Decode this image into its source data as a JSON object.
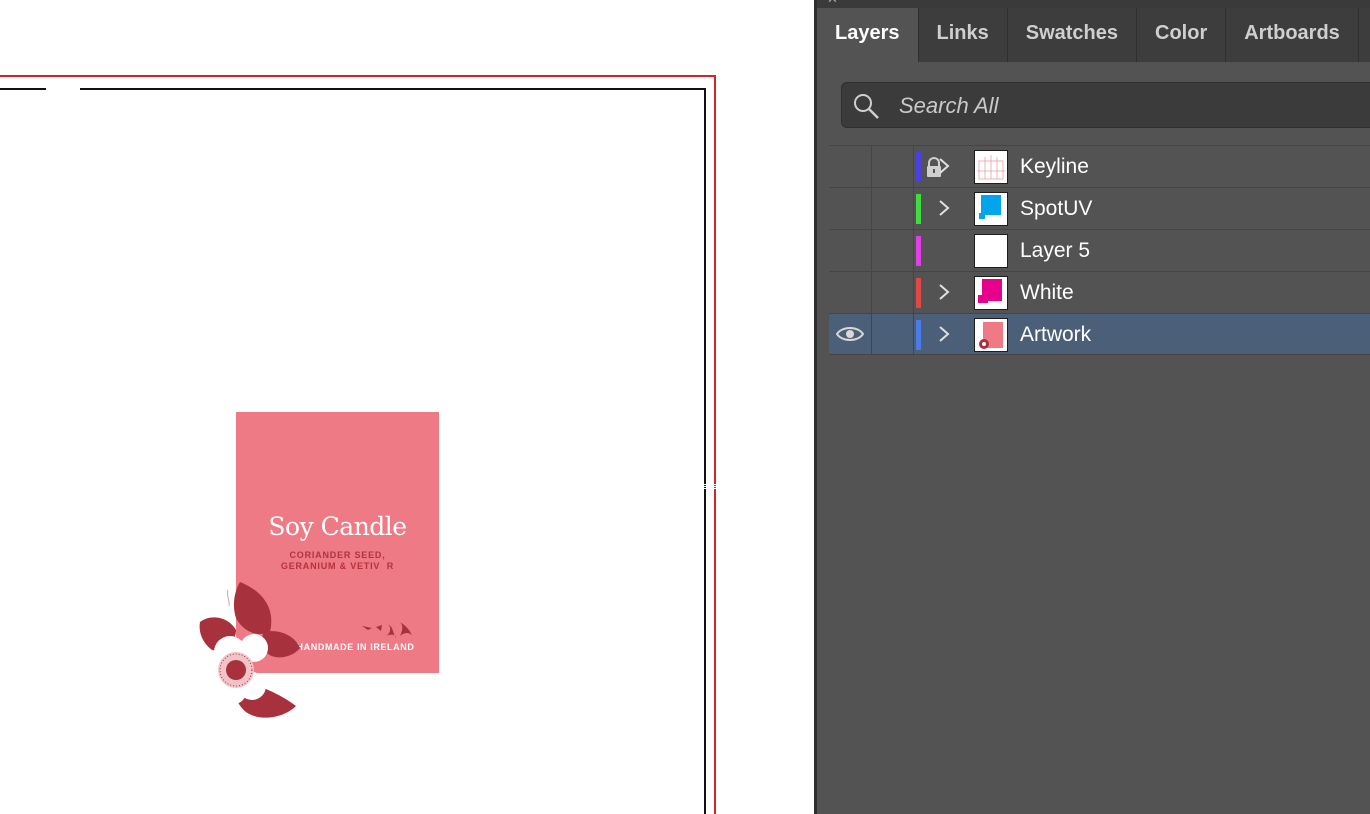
{
  "panel": {
    "tabs": [
      {
        "label": "Layers",
        "active": true
      },
      {
        "label": "Links",
        "active": false
      },
      {
        "label": "Swatches",
        "active": false
      },
      {
        "label": "Color",
        "active": false
      },
      {
        "label": "Artboards",
        "active": false
      }
    ],
    "search": {
      "placeholder": "Search All",
      "value": ""
    },
    "layers": [
      {
        "name": "Keyline",
        "color": "#4b3fe3",
        "locked": true,
        "visible": false,
        "expandable": true,
        "selected": false
      },
      {
        "name": "SpotUV",
        "color": "#3fdc3f",
        "locked": false,
        "visible": false,
        "expandable": true,
        "selected": false
      },
      {
        "name": "Layer 5",
        "color": "#e23ee5",
        "locked": false,
        "visible": false,
        "expandable": false,
        "selected": false
      },
      {
        "name": "White",
        "color": "#e04848",
        "locked": false,
        "visible": false,
        "expandable": true,
        "selected": false
      },
      {
        "name": "Artwork",
        "color": "#4a7be8",
        "locked": false,
        "visible": true,
        "expandable": true,
        "selected": true
      }
    ]
  },
  "artwork": {
    "title": "Soy Candle",
    "subtitle_line1": "CORIANDER SEED,",
    "subtitle_line2": "GERANIUM & VETIV  R",
    "footer": "HANDMADE IN IRELAND",
    "colors": {
      "label": "#ed7a84",
      "accent": "#a7323e",
      "bleed": "#d0242d",
      "trim": "#111111"
    }
  }
}
